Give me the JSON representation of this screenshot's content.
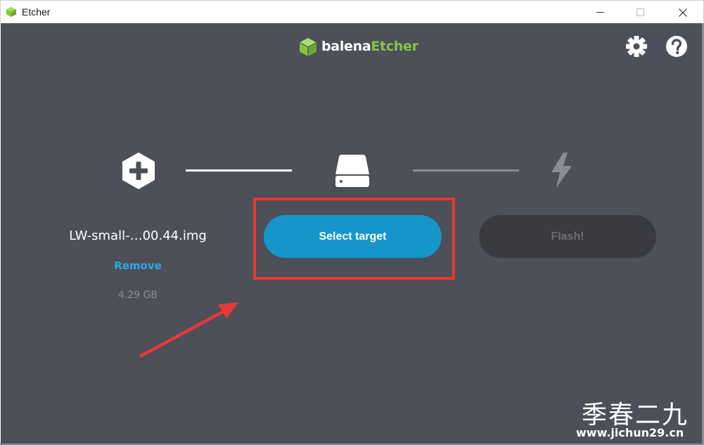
{
  "window": {
    "title": "Etcher",
    "app_icon": "etcher-cube-icon",
    "controls": [
      "minimize-icon",
      "maximize-icon",
      "close-icon"
    ]
  },
  "header": {
    "logo_prefix": "balena",
    "logo_accent": "Etcher",
    "settings_icon": "gear-icon",
    "help_icon": "question-icon"
  },
  "steps": {
    "source": {
      "icon": "plus-hexagon-icon",
      "image_name": "LW-small-…00.44.img",
      "remove_label": "Remove",
      "size": "4.29 GB"
    },
    "target": {
      "icon": "drive-icon",
      "button_label": "Select target"
    },
    "flash": {
      "icon": "lightning-icon",
      "button_label": "Flash!"
    }
  },
  "annotation": {
    "highlight_color": "#e53935",
    "arrow_color": "#e53935"
  },
  "watermark": {
    "text": "季春二九",
    "url": "www.jichun29.cn"
  },
  "colors": {
    "background": "#4d4f59",
    "accent_blue": "#1595ca",
    "link_blue": "#2ea6e0",
    "brand_green": "#85c441",
    "disabled_button": "#3a3b41"
  }
}
